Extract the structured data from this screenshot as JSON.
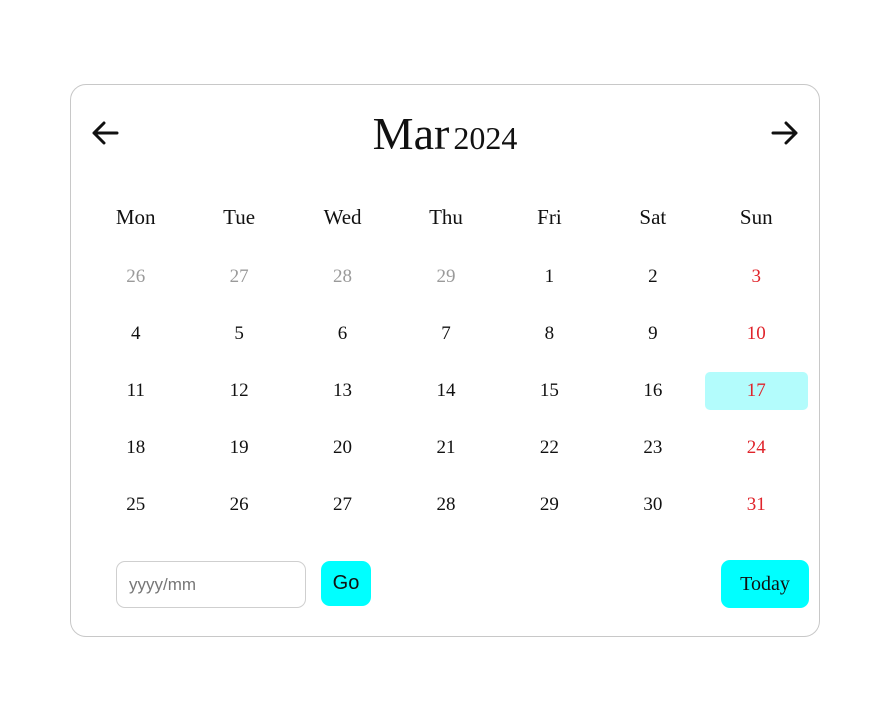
{
  "header": {
    "month": "Mar",
    "year": "2024",
    "prev_icon": "arrow-left-icon",
    "next_icon": "arrow-right-icon"
  },
  "weekdays": [
    "Mon",
    "Tue",
    "Wed",
    "Thu",
    "Fri",
    "Sat",
    "Sun"
  ],
  "weeks": [
    [
      {
        "d": "26",
        "t": "other"
      },
      {
        "d": "27",
        "t": "other"
      },
      {
        "d": "28",
        "t": "other"
      },
      {
        "d": "29",
        "t": "other"
      },
      {
        "d": "1",
        "t": "cur"
      },
      {
        "d": "2",
        "t": "cur"
      },
      {
        "d": "3",
        "t": "sun"
      }
    ],
    [
      {
        "d": "4",
        "t": "cur"
      },
      {
        "d": "5",
        "t": "cur"
      },
      {
        "d": "6",
        "t": "cur"
      },
      {
        "d": "7",
        "t": "cur"
      },
      {
        "d": "8",
        "t": "cur"
      },
      {
        "d": "9",
        "t": "cur"
      },
      {
        "d": "10",
        "t": "sun"
      }
    ],
    [
      {
        "d": "11",
        "t": "cur"
      },
      {
        "d": "12",
        "t": "cur"
      },
      {
        "d": "13",
        "t": "cur"
      },
      {
        "d": "14",
        "t": "cur"
      },
      {
        "d": "15",
        "t": "cur"
      },
      {
        "d": "16",
        "t": "cur"
      },
      {
        "d": "17",
        "t": "sun",
        "today": true
      }
    ],
    [
      {
        "d": "18",
        "t": "cur"
      },
      {
        "d": "19",
        "t": "cur"
      },
      {
        "d": "20",
        "t": "cur"
      },
      {
        "d": "21",
        "t": "cur"
      },
      {
        "d": "22",
        "t": "cur"
      },
      {
        "d": "23",
        "t": "cur"
      },
      {
        "d": "24",
        "t": "sun"
      }
    ],
    [
      {
        "d": "25",
        "t": "cur"
      },
      {
        "d": "26",
        "t": "cur"
      },
      {
        "d": "27",
        "t": "cur"
      },
      {
        "d": "28",
        "t": "cur"
      },
      {
        "d": "29",
        "t": "cur"
      },
      {
        "d": "30",
        "t": "cur"
      },
      {
        "d": "31",
        "t": "sun"
      }
    ]
  ],
  "footer": {
    "input_placeholder": "yyyy/mm",
    "input_value": "",
    "go_label": "Go",
    "today_label": "Today"
  },
  "colors": {
    "accent": "#00ffff",
    "today_highlight": "#b3fcfc",
    "sunday": "#e0242b",
    "other_month": "#9a9a9a",
    "border": "#c8c8c8"
  }
}
